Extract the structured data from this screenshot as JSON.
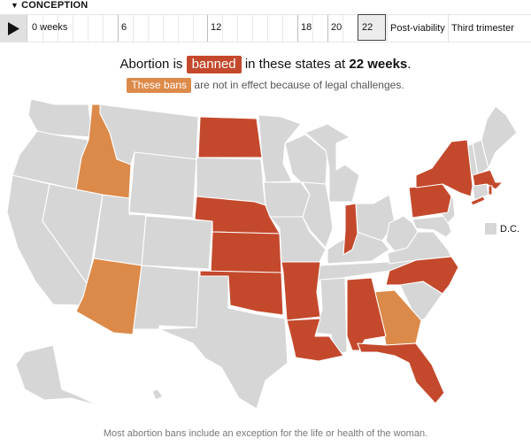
{
  "timeline": {
    "header_label": "CONCEPTION",
    "header_icon": "triangle-down-icon",
    "play_icon": "play-icon",
    "ticks": [
      {
        "label": "0 weeks",
        "week": 0
      },
      {
        "label": "6",
        "week": 6
      },
      {
        "label": "12",
        "week": 12
      },
      {
        "label": "18",
        "week": 18
      },
      {
        "label": "20",
        "week": 20
      },
      {
        "label": "22",
        "week": 22
      }
    ],
    "segments": [
      "Post-viability",
      "Third trimester"
    ],
    "selected": "22"
  },
  "headline": {
    "prefix": "Abortion is",
    "badge": "banned",
    "middle": "in these states at",
    "emphasis": "22 weeks",
    "suffix": "."
  },
  "subline": {
    "badge": "These bans",
    "text": "are not in effect because of legal challenges."
  },
  "legend": {
    "dc_label": "D.C."
  },
  "footnote": "Most abortion bans include an exception for the life or health of the woman.",
  "colors": {
    "banned": "#c4492c",
    "blocked": "#dc8a4a",
    "no_ban": "#d6d6d6"
  },
  "map": {
    "status_by_state": {
      "banned": [
        "ND",
        "NE",
        "KS",
        "OK",
        "AR",
        "LA",
        "IN",
        "AL",
        "FL",
        "NC",
        "PA",
        "NY",
        "MA",
        "RI",
        "CT-part"
      ],
      "blocked": [
        "ID",
        "AZ",
        "GA"
      ]
    }
  }
}
